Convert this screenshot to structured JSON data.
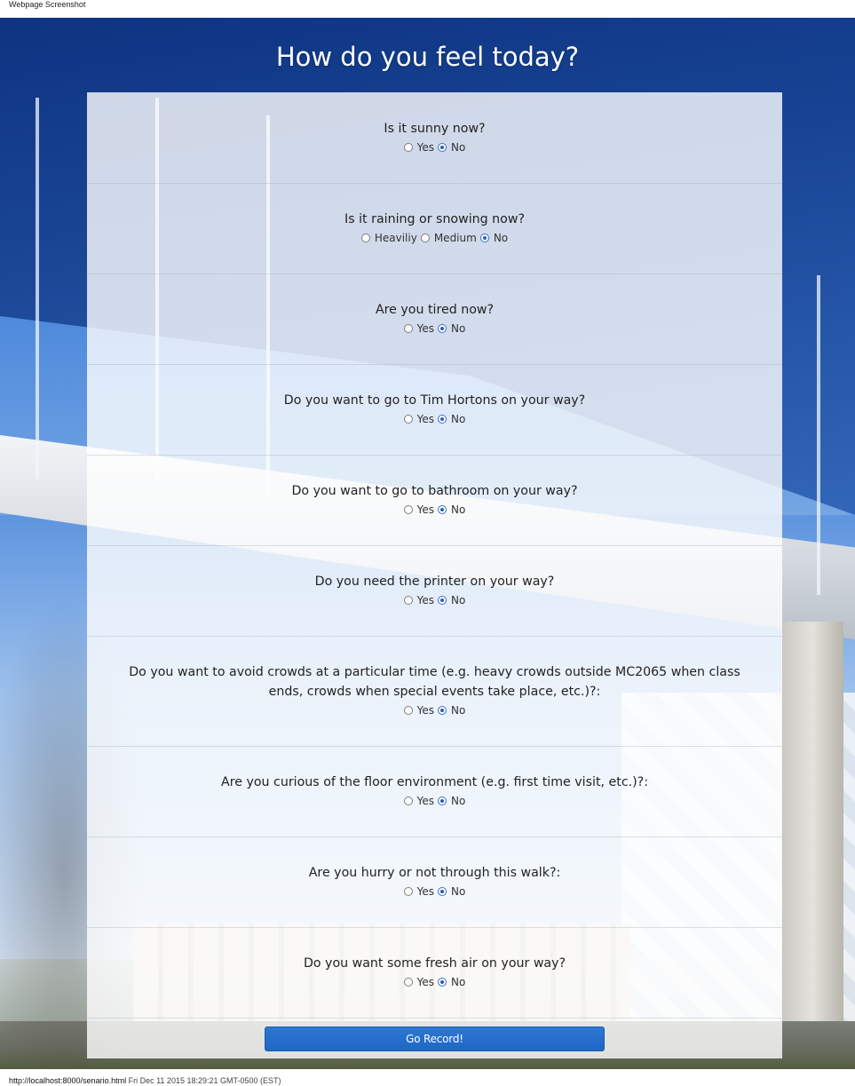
{
  "header_caption": "Webpage Screenshot",
  "footer": {
    "url": "http://localhost:8000/senario.html",
    "timestamp": "Fri Dec 11 2015 18:29:21 GMT-0500 (EST)"
  },
  "page_title": "How do you feel today?",
  "questions": [
    {
      "text": "Is it sunny now?",
      "options": [
        "Yes",
        "No"
      ],
      "selected": "No"
    },
    {
      "text": "Is it raining or snowing now?",
      "options": [
        "Heaviliy",
        "Medium",
        "No"
      ],
      "selected": "No"
    },
    {
      "text": "Are you tired now?",
      "options": [
        "Yes",
        "No"
      ],
      "selected": "No"
    },
    {
      "text": "Do you want to go to Tim Hortons on your way?",
      "options": [
        "Yes",
        "No"
      ],
      "selected": "No"
    },
    {
      "text": "Do you want to go to bathroom on your way?",
      "options": [
        "Yes",
        "No"
      ],
      "selected": "No"
    },
    {
      "text": "Do you need the printer on your way?",
      "options": [
        "Yes",
        "No"
      ],
      "selected": "No"
    },
    {
      "text": "Do you want to avoid crowds at a particular time (e.g. heavy crowds outside MC2065 when class ends, crowds when special events take place, etc.)?:",
      "options": [
        "Yes",
        "No"
      ],
      "selected": "No"
    },
    {
      "text": "Are you curious of the floor environment (e.g. first time visit, etc.)?:",
      "options": [
        "Yes",
        "No"
      ],
      "selected": "No"
    },
    {
      "text": "Are you hurry or not through this walk?:",
      "options": [
        "Yes",
        "No"
      ],
      "selected": "No"
    },
    {
      "text": "Do you want some fresh air on your way?",
      "options": [
        "Yes",
        "No"
      ],
      "selected": "No"
    }
  ],
  "submit_label": "Go Record!",
  "colors": {
    "button": "#1e66c4",
    "radio_selected": "#2a5cb8",
    "title": "#ffffff"
  }
}
